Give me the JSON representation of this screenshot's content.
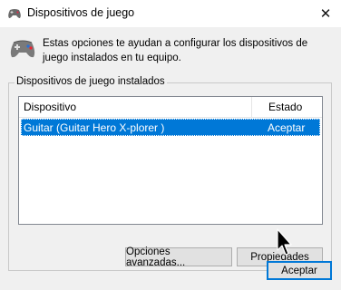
{
  "window": {
    "title": "Dispositivos de juego",
    "close_glyph": "✕"
  },
  "info": {
    "icon": "gamepad-icon",
    "text": "Estas opciones te ayudan a configurar los dispositivos de juego instalados en tu equipo."
  },
  "group": {
    "label": "Dispositivos de juego instalados",
    "columns": {
      "device": "Dispositivo",
      "status": "Estado"
    },
    "rows": [
      {
        "device": "Guitar (Guitar Hero X-plorer  )",
        "status": "Aceptar",
        "selected": true
      }
    ]
  },
  "buttons": {
    "advanced": "Opciones avanzadas...",
    "properties": "Propiedades",
    "accept": "Aceptar"
  },
  "colors": {
    "selection": "#0078d7",
    "client_bg": "#f0f0f0"
  }
}
